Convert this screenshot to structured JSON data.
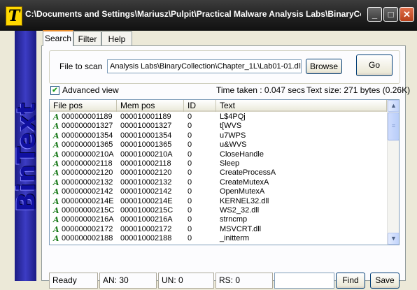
{
  "window": {
    "title": "C:\\Documents and Settings\\Mariusz\\Pulpit\\Practical Malware Analysis Labs\\BinaryCollect...",
    "app_icon_letter": "T",
    "minimize": "_",
    "maximize": "□",
    "close": "✕"
  },
  "sidebar": {
    "logo": "BinText"
  },
  "tabs": [
    {
      "label": "Search",
      "active": true
    },
    {
      "label": "Filter",
      "active": false
    },
    {
      "label": "Help",
      "active": false
    }
  ],
  "scan": {
    "label": "File to scan",
    "file_value": "Analysis Labs\\BinaryCollection\\Chapter_1L\\Lab01-01.dll",
    "browse": "Browse",
    "go": "Go"
  },
  "options": {
    "advanced_view_label": "Advanced view",
    "advanced_view_checked": true,
    "check_mark": "✔",
    "time_taken": "Time taken : 0.047 secs",
    "text_size": "Text size: 271 bytes (0.26K)"
  },
  "table": {
    "columns": [
      "File pos",
      "Mem pos",
      "ID",
      "Text"
    ],
    "row_icon": "A",
    "rows": [
      [
        "000000001189",
        "000010001189",
        "0",
        "L$4PQj"
      ],
      [
        "000000001327",
        "000010001327",
        "0",
        "t[WVS"
      ],
      [
        "000000001354",
        "000010001354",
        "0",
        "u7WPS"
      ],
      [
        "000000001365",
        "000010001365",
        "0",
        "u&WVS"
      ],
      [
        "00000000210A",
        "00001000210A",
        "0",
        "CloseHandle"
      ],
      [
        "000000002118",
        "000010002118",
        "0",
        "Sleep"
      ],
      [
        "000000002120",
        "000010002120",
        "0",
        "CreateProcessA"
      ],
      [
        "000000002132",
        "000010002132",
        "0",
        "CreateMutexA"
      ],
      [
        "000000002142",
        "000010002142",
        "0",
        "OpenMutexA"
      ],
      [
        "00000000214E",
        "00001000214E",
        "0",
        "KERNEL32.dll"
      ],
      [
        "00000000215C",
        "00001000215C",
        "0",
        "WS2_32.dll"
      ],
      [
        "00000000216A",
        "00001000216A",
        "0",
        "strncmp"
      ],
      [
        "000000002172",
        "000010002172",
        "0",
        "MSVCRT.dll"
      ],
      [
        "000000002188",
        "000010002188",
        "0",
        "_initterm"
      ]
    ],
    "scroll_up": "▲",
    "scroll_down": "▼",
    "thumb_grip": "≡"
  },
  "statusbar": {
    "ready": "Ready",
    "an": "AN: 30",
    "un": "UN: 0",
    "rs": "RS: 0",
    "find_value": "",
    "find": "Find",
    "save": "Save"
  }
}
